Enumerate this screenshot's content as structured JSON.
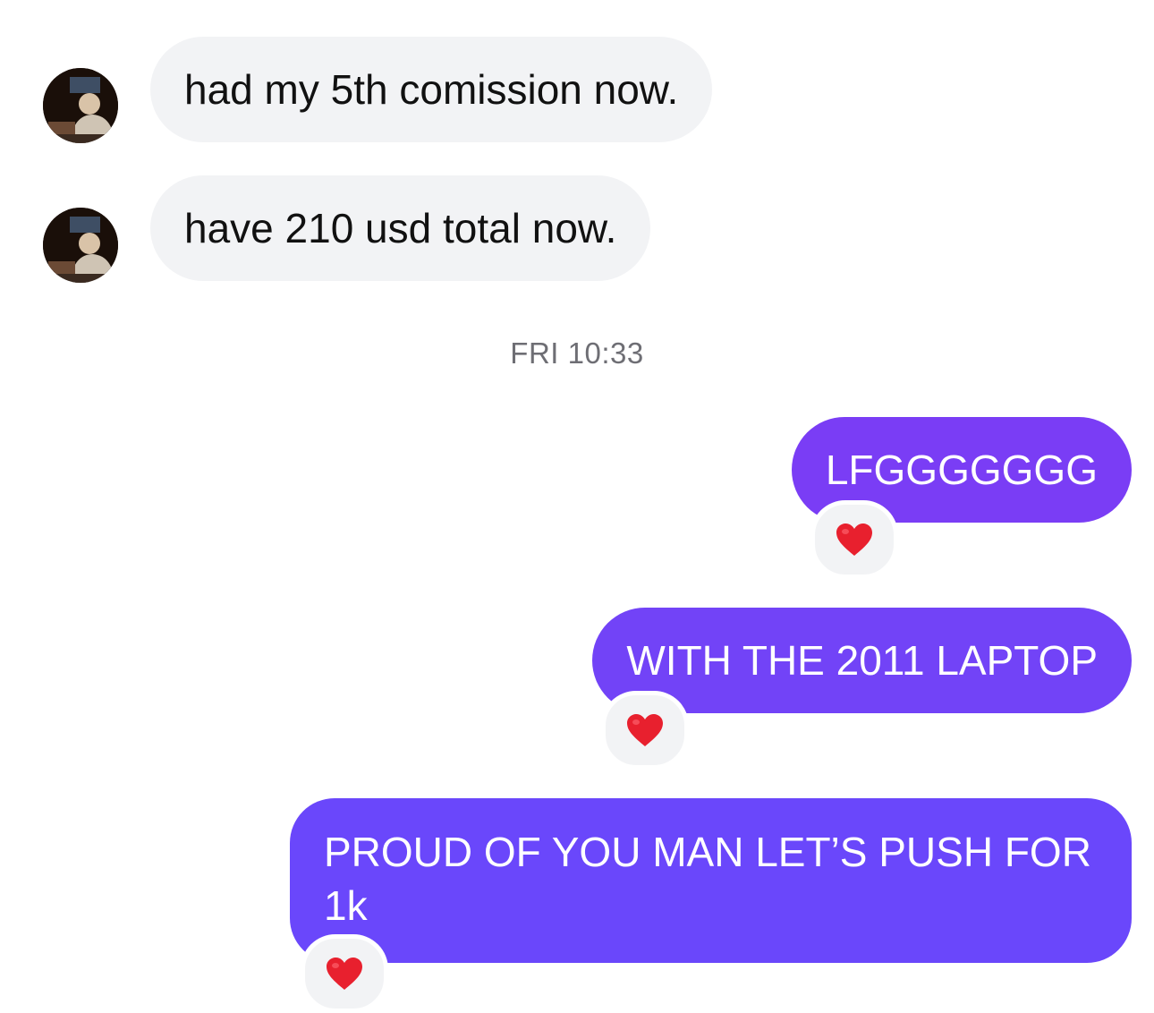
{
  "thread": {
    "incoming": [
      {
        "text": "had my 5th comission now."
      },
      {
        "text": "have 210 usd total now."
      }
    ],
    "timestamp": "FRI 10:33",
    "outgoing": [
      {
        "text": "LFGGGGGGG",
        "reaction": "heart"
      },
      {
        "text": "WITH THE 2011 LAPTOP",
        "reaction": "heart"
      },
      {
        "text": "PROUD OF YOU MAN LET’S PUSH FOR 1k",
        "reaction": "heart"
      }
    ]
  },
  "colors": {
    "incoming_bubble": "#f2f3f5",
    "outgoing_bubble_top": "#7a3df5",
    "outgoing_bubble_bottom": "#6a47fb",
    "heart": "#e8202e",
    "timestamp_text": "#6e6e74"
  },
  "icons": {
    "reaction": "red-heart-icon",
    "sender_avatar": "avatar"
  }
}
